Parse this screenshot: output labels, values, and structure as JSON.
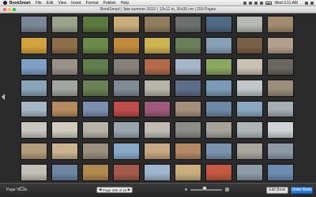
{
  "menubar": {
    "app_name": "BookSmart",
    "items": [
      "File",
      "Edit",
      "View",
      "Insert",
      "Format",
      "Publish",
      "Help"
    ],
    "clock": "Wed 3:11 AM"
  },
  "window": {
    "title": "BookSmart | 'late summer 2019' | 12x12 in, 30x30 cm | 250 Pages"
  },
  "bottombar": {
    "page_views_label": "Page Views",
    "page_field": "Page 250 of 250",
    "edit_book_label": "Edit Book",
    "order_book_label": "Order Book",
    "zoom_level": 0.45
  },
  "colors": {
    "background": "#2b2b2b",
    "accent": "#1f6fd1"
  },
  "photos": [
    "#7a8794",
    "#9aa38a",
    "#5c7a3f",
    "#c9ad7a",
    "#8f7d5e",
    "#6d6f6e",
    "#4f6a86",
    "#b7b9b4",
    "#a38c6e",
    "#d4a43c",
    "#8f6e4a",
    "#6b8a4c",
    "#c08b3a",
    "#cfb34f",
    "#6c7f5b",
    "#88a0b6",
    "#7a6048",
    "#b3a08c",
    "#7fa0c4",
    "#99908a",
    "#5f7e4b",
    "#88807a",
    "#b26a4a",
    "#a5b6c8",
    "#8aa85e",
    "#c9c2b2",
    "#6a6761",
    "#8ba3b9",
    "#a2a8a0",
    "#6a8055",
    "#7f8b95",
    "#b6b6a8",
    "#5d6e8a",
    "#7a9bb8",
    "#c1c6c9",
    "#9b8e7c",
    "#a7b6c5",
    "#b58a5c",
    "#7c8fae",
    "#c04b4b",
    "#9d5a7a",
    "#a48f7b",
    "#6d8aa4",
    "#8aa7c0",
    "#a6afb4",
    "#c9c7c0",
    "#d0cbbe",
    "#b8b3a6",
    "#9aa5ad",
    "#c1bdb5",
    "#8c8d87",
    "#a7a39a",
    "#b0b6b8",
    "#cfd3d5",
    "#b49b7a",
    "#cbb390",
    "#9b8f7d",
    "#87aac8",
    "#c6a883",
    "#b48a64",
    "#7b94ad",
    "#a9a79f",
    "#8c9aa6",
    "#c2bfb7",
    "#6f86a3",
    "#b0894f",
    "#a35a4a",
    "#9fb6cc",
    "#c9b07e",
    "#c3593e",
    "#8d9da6",
    "#6d8db0"
  ]
}
